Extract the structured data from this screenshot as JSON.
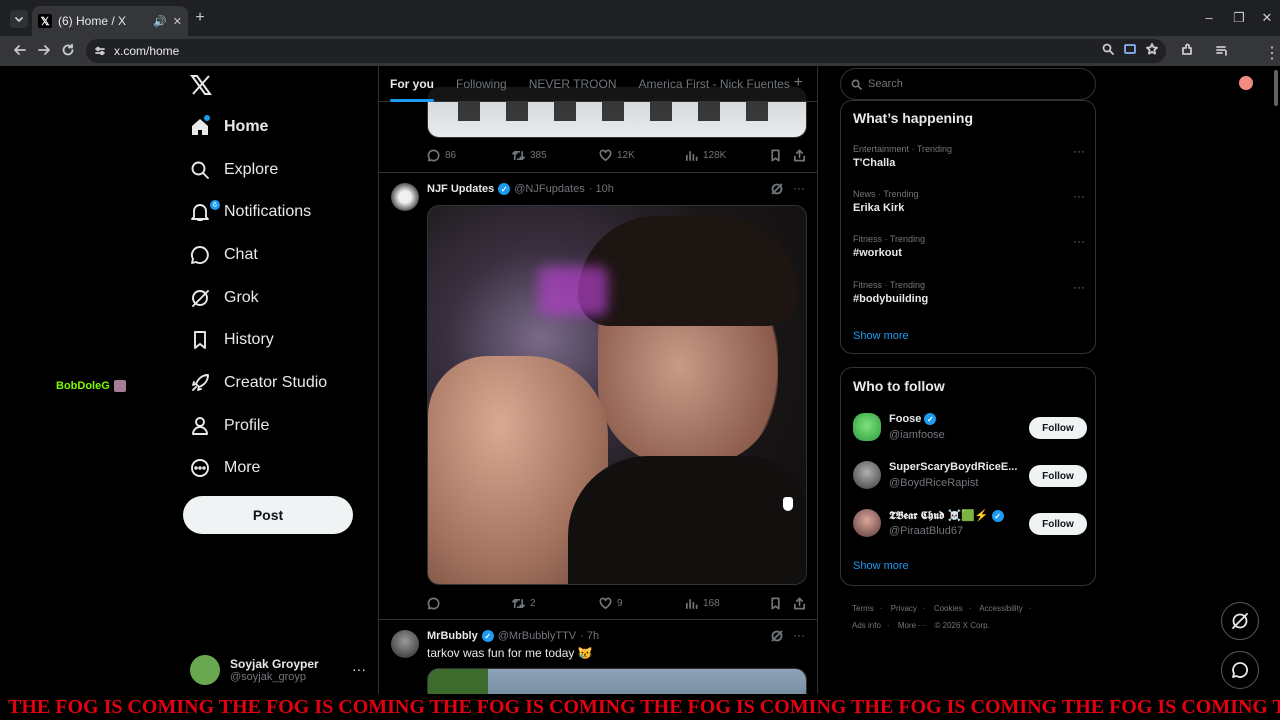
{
  "browser": {
    "tab_title": "(6) Home / X",
    "url": "x.com/home",
    "new_tab": "+"
  },
  "nav": {
    "logo": "X",
    "items": [
      {
        "label": "Home",
        "icon": "home-icon"
      },
      {
        "label": "Explore",
        "icon": "search-icon"
      },
      {
        "label": "Notifications",
        "icon": "bell-icon",
        "badge": "6"
      },
      {
        "label": "Chat",
        "icon": "chat-icon"
      },
      {
        "label": "Grok",
        "icon": "grok-icon"
      },
      {
        "label": "History",
        "icon": "bookmark-icon"
      },
      {
        "label": "Creator Studio",
        "icon": "rocket-icon"
      },
      {
        "label": "Profile",
        "icon": "person-icon"
      },
      {
        "label": "More",
        "icon": "more-circle-icon"
      }
    ],
    "post_label": "Post",
    "account": {
      "name": "Soyjak Groyper",
      "handle": "@soyjak_groyp"
    }
  },
  "overlay_user": "BobDoleG",
  "feed": {
    "tabs": [
      "For you",
      "Following",
      "NEVER TROON",
      "America First - Nick Fuentes"
    ],
    "top_post_actions": {
      "replies": "86",
      "reposts": "385",
      "likes": "12K",
      "views": "128K"
    },
    "posts": [
      {
        "name": "NJF Updates",
        "handle": "@NJFupdates",
        "time": "· 10h",
        "actions": {
          "replies": "",
          "reposts": "2",
          "likes": "9",
          "views": "168"
        }
      },
      {
        "name": "MrBubbly",
        "handle": "@MrBubblyTTV",
        "time": "· 7h",
        "text": "tarkov was fun for me today 😿"
      }
    ]
  },
  "right": {
    "search_placeholder": "Search",
    "happening_title": "What’s happening",
    "trends": [
      {
        "context": "Entertainment · Trending",
        "name": "T'Challa"
      },
      {
        "context": "News · Trending",
        "name": "Erika Kirk"
      },
      {
        "context": "Fitness · Trending",
        "name": "#workout"
      },
      {
        "context": "Fitness · Trending",
        "name": "#bodybuilding"
      }
    ],
    "show_more": "Show more",
    "who_title": "Who to follow",
    "who": [
      {
        "name": "Foose",
        "handle": "@iamfoose",
        "verified": true
      },
      {
        "name": "SuperScaryBoydRiceE...",
        "handle": "@BoydRiceRapist",
        "verified": false
      },
      {
        "name": "𝕿𝕭𝖊𝖆𝖗 𝕮𝖍𝖚𝖉 ☠️🟩⚡",
        "handle": "@PiraatBlud67",
        "verified": true
      }
    ],
    "follow_label": "Follow",
    "who_show_more": "Show more",
    "footer": [
      "Terms",
      "·",
      "Privacy",
      "·",
      "Cookies",
      "·",
      "Accessibility",
      "·",
      "Ads info",
      "·",
      "More ···",
      "© 2026 X Corp."
    ]
  },
  "banner": "THE FOG IS COMING THE FOG IS COMING THE FOG IS COMING THE FOG IS COMING THE FOG IS COMING THE FOG IS COMING THE FOG IS COMING THE FOG IS COMING THE FOG IS COMING",
  "colors": {
    "accent": "#1d9bf0",
    "banner_red": "#e3000f",
    "overlay_green": "#7cfc00"
  }
}
